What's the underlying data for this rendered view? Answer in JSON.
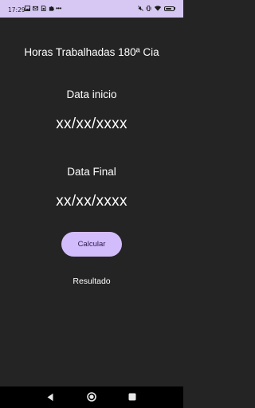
{
  "status_bar": {
    "time": "17:29",
    "left_icons": [
      "photo-icon",
      "mail-icon",
      "sim-icon",
      "puzzle-icon"
    ],
    "more_indicator": "•••",
    "right_icons": [
      "mute-icon",
      "vibrate-icon",
      "wifi-icon",
      "battery-icon"
    ],
    "battery_level": 0.8
  },
  "app": {
    "title": "Horas Trabalhadas 180ª Cia",
    "start_label": "Data inicio",
    "start_value": "xx/xx/xxxx",
    "end_label": "Data Final",
    "end_value": "xx/xx/xxxx",
    "calculate_label": "Calcular",
    "result_label": "Resultado"
  },
  "colors": {
    "background": "#242424",
    "status_bar": "#d6c8f2",
    "button": "#d3bcfc",
    "nav_bar": "#000000"
  },
  "nav_bar": {
    "icons": [
      "back-icon",
      "home-icon",
      "recents-icon"
    ]
  }
}
